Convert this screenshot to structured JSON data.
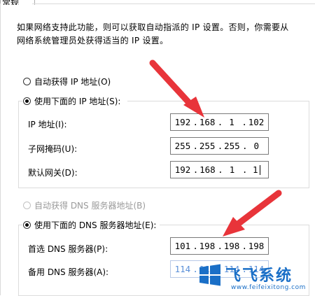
{
  "tab": {
    "label": "常规"
  },
  "info_text": "如果网络支持此功能，则可以获取自动指派的 IP 设置。否则，你需要从网络系统管理员处获得适当的 IP 设置。",
  "ip_section": {
    "auto_radio_label": "自动获得 IP 地址(O)",
    "manual_radio_label": "使用下面的 IP 地址(S):",
    "fields": [
      {
        "label": "IP 地址(I):",
        "octets": [
          "192",
          "168",
          "1",
          "102"
        ]
      },
      {
        "label": "子网掩码(U):",
        "octets": [
          "255",
          "255",
          "255",
          "0"
        ]
      },
      {
        "label": "默认网关(D):",
        "octets": [
          "192",
          "168",
          "1",
          "1"
        ]
      }
    ]
  },
  "dns_section": {
    "auto_radio_label": "自动获得 DNS 服务器地址(B)",
    "manual_radio_label": "使用下面的 DNS 服务器地址(E):",
    "fields": [
      {
        "label": "首选 DNS 服务器(P):",
        "octets": [
          "101",
          "198",
          "198",
          "198"
        ]
      },
      {
        "label": "备用 DNS 服务器(A):",
        "octets": [
          "114",
          "114",
          "114",
          "114"
        ]
      }
    ]
  },
  "watermark": {
    "brand": "飞飞系统",
    "url": "www.feifeixitong.com"
  },
  "colors": {
    "arrow": "#e8343a",
    "accent": "#1a6fc7"
  }
}
